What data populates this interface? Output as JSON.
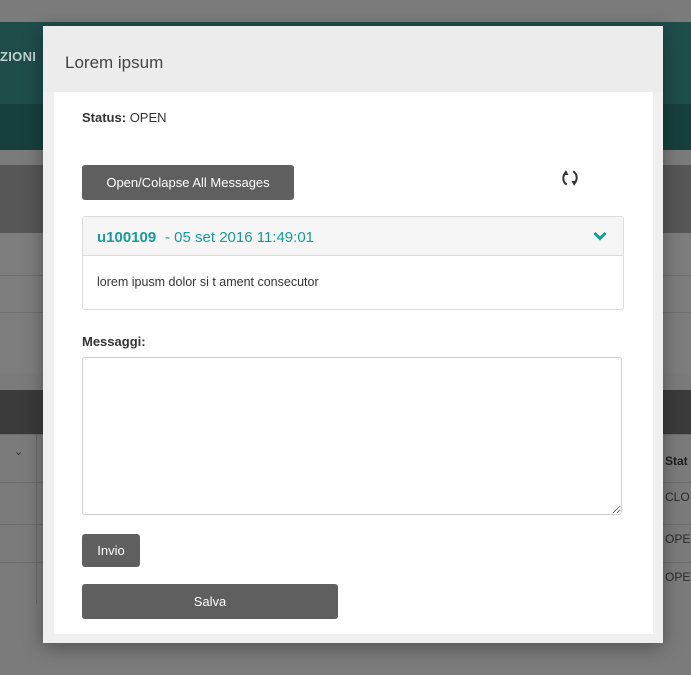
{
  "background": {
    "menu_fragment": "ZIONI",
    "table": {
      "header_fragment": "Stat",
      "rows": [
        "CLO",
        "OPE",
        "OPE"
      ]
    }
  },
  "modal": {
    "title": "Lorem ipsum",
    "status_label": "Status:",
    "status_value": "OPEN",
    "collapse_button": "Open/Colapse All Messages",
    "refresh_icon": "refresh-icon",
    "message": {
      "user": "u100109",
      "date": " - 05 set 2016 11:49:01",
      "body": "lorem ipusm dolor si t ament consecutor",
      "toggle_icon": "chevron-down-icon"
    },
    "messages_label": "Messaggi:",
    "messages_value": "",
    "send_button": "Invio",
    "save_button": "Salva"
  },
  "colors": {
    "accent": "#1a9a9a",
    "button": "#5f5f5f",
    "overlay_teal": "#1f4d4a"
  }
}
